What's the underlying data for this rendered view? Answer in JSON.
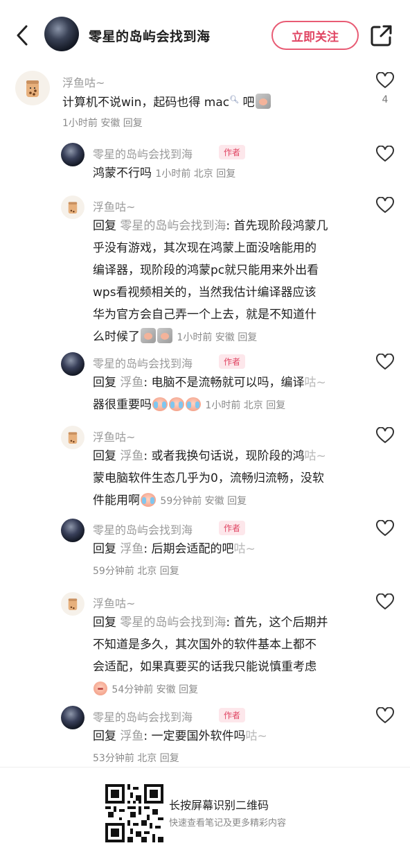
{
  "header": {
    "title": "零星的岛屿会找到海",
    "follow_label": "立即关注"
  },
  "comments": [
    {
      "nickname": "浮鱼咕~",
      "text": "计算机不说win，起码也得 mac",
      "text_tail": "吧",
      "meta": "1小时前 安徽 回复",
      "like_count": "4"
    },
    {
      "nickname": "零星的岛屿会找到海",
      "author_tag": "作者",
      "text": "鸿蒙不行吗",
      "meta": "1小时前 北京 回复"
    },
    {
      "nickname": "浮鱼咕~",
      "reply_prefix": "回复",
      "reply_to": "零星的岛屿会找到海",
      "text_lines": [
        "首先现阶段鸿蒙几",
        "乎没有游戏，其次现在鸿蒙上面没啥能用的",
        "编译器，现阶段的鸿蒙pc就只能用来外出看",
        "wps看视频相关的，当然我估计编译器应该",
        "华为官方会自己弄一个上去，就是不知道什",
        "么时候了"
      ],
      "meta": "1小时前 安徽 回复"
    },
    {
      "nickname": "零星的岛屿会找到海",
      "author_tag": "作者",
      "reply_prefix": "回复",
      "reply_to": "浮鱼",
      "text_lines": [
        "电脑不是流畅就可以吗，编译",
        "器很重要吗"
      ],
      "ghost": "咕~",
      "meta": "1小时前 北京 回复"
    },
    {
      "nickname": "浮鱼咕~",
      "reply_prefix": "回复",
      "reply_to": "浮鱼",
      "text_lines": [
        "或者我换句话说，现阶段的鸿",
        "蒙电脑软件生态几乎为0，流畅归流畅，没软",
        "件能用啊"
      ],
      "ghost": "咕~",
      "meta": "59分钟前 安徽 回复"
    },
    {
      "nickname": "零星的岛屿会找到海",
      "author_tag": "作者",
      "reply_prefix": "回复",
      "reply_to": "浮鱼",
      "text": "后期会适配的吧",
      "ghost": "咕~",
      "meta": "59分钟前 北京 回复"
    },
    {
      "nickname": "浮鱼咕~",
      "reply_prefix": "回复",
      "reply_to": "零星的岛屿会找到海",
      "text_lines": [
        "首先，这个后期并",
        "不知道是多久，其次国外的软件基本上都不",
        "会适配，如果真要买的话我只能说慎重考虑"
      ],
      "meta": "54分钟前 安徽 回复"
    },
    {
      "nickname": "零星的岛屿会找到海",
      "author_tag": "作者",
      "reply_prefix": "回复",
      "reply_to": "浮鱼",
      "text": "一定要国外软件吗",
      "ghost": "咕~",
      "meta": "53分钟前 北京 回复"
    }
  ],
  "footer": {
    "title": "长按屏幕识别二维码",
    "subtitle": "快速查看笔记及更多精彩内容"
  }
}
